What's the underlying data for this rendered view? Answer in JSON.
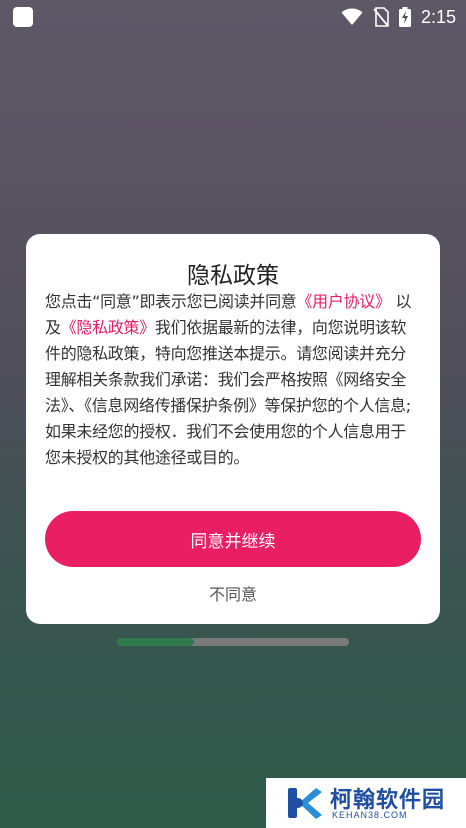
{
  "status_bar": {
    "time": "2:15",
    "icons": [
      "app-notification-icon",
      "wifi-icon",
      "no-sim-icon",
      "battery-charging-icon"
    ]
  },
  "dialog": {
    "title": "隐私政策",
    "body": {
      "part1": "您点击“同意”即表示您已阅读并同意",
      "user_agreement_link": "《用户协议》",
      "part2": "以及",
      "privacy_policy_link": "《隐私政策》",
      "part3": "我们依据最新的法律，向您说明该软件的隐私政策，特向您推送本提示。请您阅读并充分理解相关条款我们承诺：我们会严格按照《网络安全法》、《信息网络传播保护条例》等保护您的个人信息;如果未经您的授权．我们不会使用您的个人信息用于您未授权的其他途径或目的。"
    },
    "agree_label": "同意并继续",
    "disagree_label": "不同意"
  },
  "progress": {
    "value": 0.33
  },
  "colors": {
    "accent": "#e91e63",
    "link": "#e61f64",
    "progress_fill": "#2f7a4d"
  },
  "watermark": {
    "name": "柯翰软件园",
    "url": "KEHAN38.COM"
  }
}
